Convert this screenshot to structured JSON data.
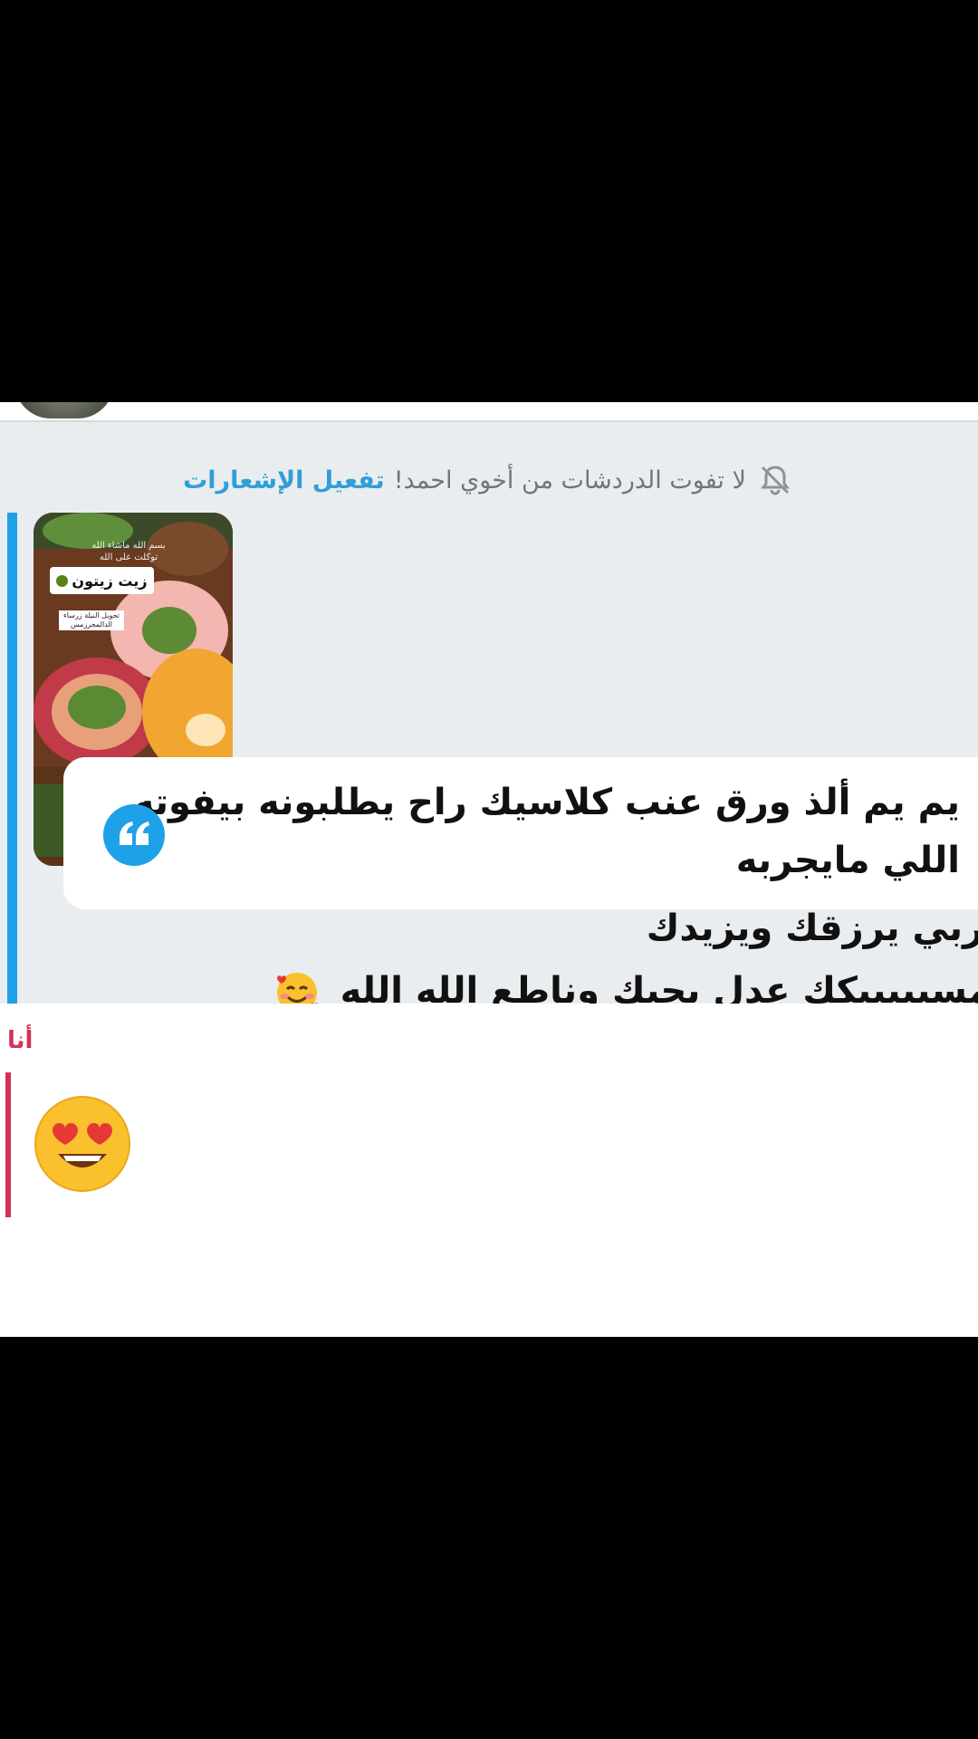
{
  "notification": {
    "message": "لا تفوت الدردشات من أخوي احمد!",
    "action": "تفعيل الإشعارات"
  },
  "media": {
    "tag_text": "زيت زيتون",
    "caption_top": "بسم الله ماشاء الله توكلت على الله",
    "caption_small": "تحويل النيلة زرساء الدالمجرزمس"
  },
  "quote": {
    "line1": "يم يم ألذ ورق عنب كلاسيك راح يطلبونه بيفوته",
    "line2": "اللي مايجربه"
  },
  "reply": {
    "line1": "ربي يرزقك ويزيدك",
    "line2": "مسبببببكك عدل يجيك وناطع الله الله"
  },
  "me": {
    "label": "أنا",
    "emoji_icon": "heart-eyes-emoji-icon"
  },
  "colors": {
    "accent_blue": "#1da1e8",
    "me_red": "#d2325a",
    "thread_bg": "#eaedf0"
  }
}
